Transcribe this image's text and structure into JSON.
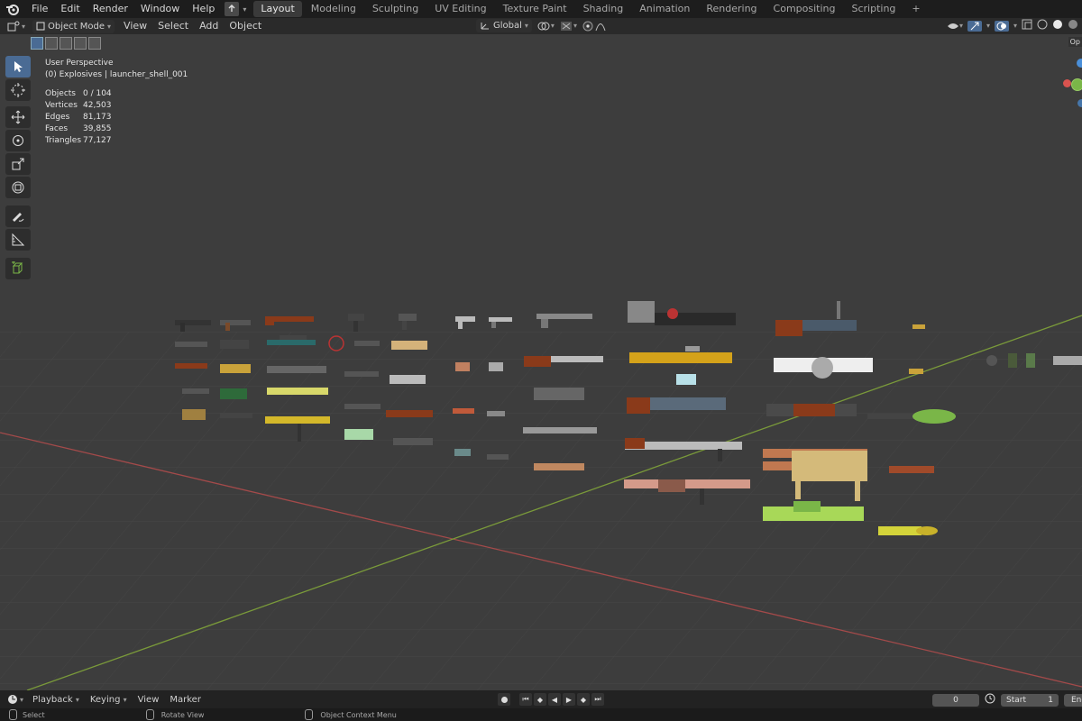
{
  "menus": [
    "File",
    "Edit",
    "Render",
    "Window",
    "Help"
  ],
  "workspaces": [
    {
      "label": "Layout",
      "active": true
    },
    {
      "label": "Modeling",
      "active": false
    },
    {
      "label": "Sculpting",
      "active": false
    },
    {
      "label": "UV Editing",
      "active": false
    },
    {
      "label": "Texture Paint",
      "active": false
    },
    {
      "label": "Shading",
      "active": false
    },
    {
      "label": "Animation",
      "active": false
    },
    {
      "label": "Rendering",
      "active": false
    },
    {
      "label": "Compositing",
      "active": false
    },
    {
      "label": "Scripting",
      "active": false
    }
  ],
  "workspace_add": "+",
  "header": {
    "mode": "Object Mode",
    "items": [
      "View",
      "Select",
      "Add",
      "Object"
    ],
    "transform_orientation": "Global"
  },
  "viewport_info": {
    "perspective": "User Perspective",
    "collection": "(0) Explosives | launcher_shell_001"
  },
  "stats": [
    {
      "label": "Objects",
      "value": "0 / 104"
    },
    {
      "label": "Vertices",
      "value": "42,503"
    },
    {
      "label": "Edges",
      "value": "81,173"
    },
    {
      "label": "Faces",
      "value": "39,855"
    },
    {
      "label": "Triangles",
      "value": "77,127"
    }
  ],
  "timeline": {
    "items": [
      "Playback",
      "Keying",
      "View",
      "Marker"
    ],
    "current_frame": "0",
    "start_label": "Start",
    "start_value": "1",
    "end_label": "End"
  },
  "statusbar": {
    "select": "Select",
    "rotate": "Rotate View",
    "context": "Object Context Menu"
  },
  "colors": {
    "grid_x_axis": "#a34a4a",
    "grid_y_axis": "#7a9a3a",
    "viewport_bg": "#3d3d3d",
    "active_tool": "#4a6b94",
    "gizmo_red": "#d9534f",
    "gizmo_green": "#7ab648",
    "gizmo_blue": "#4a8fd9"
  },
  "right_edge_label": "Op"
}
